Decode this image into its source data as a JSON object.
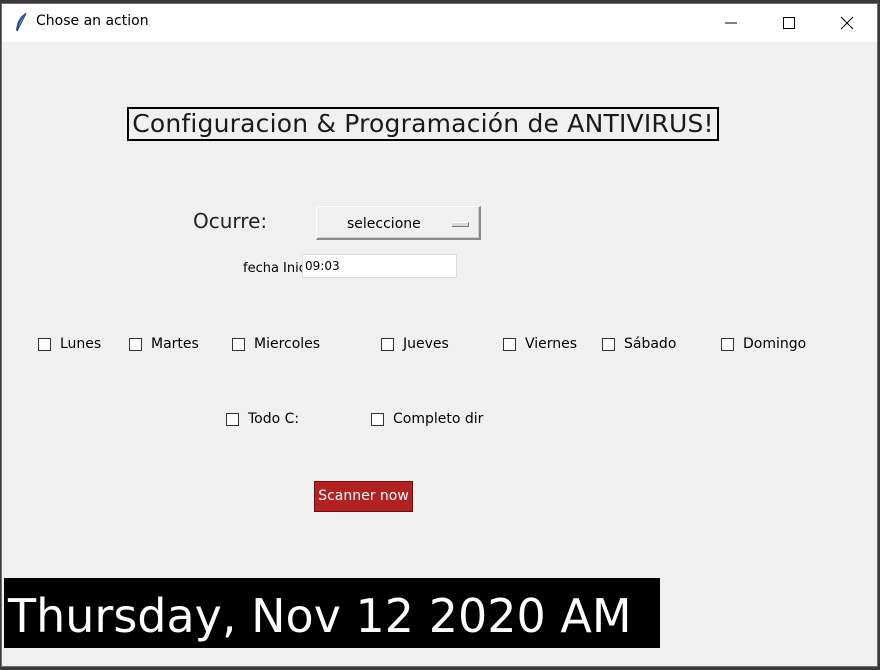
{
  "window": {
    "title": "Chose an action",
    "icons": {
      "app": "feather-icon",
      "minimize": "minimize-icon",
      "maximize": "maximize-icon",
      "close": "close-icon"
    }
  },
  "heading": "Configuracion & Programación de ANTIVIRUS!",
  "ocurre": {
    "label": "Ocurre:",
    "selected": "seleccione"
  },
  "fecha": {
    "label": "fecha Inicio",
    "value": "09:03"
  },
  "days": [
    {
      "label": "Lunes",
      "checked": false
    },
    {
      "label": "Martes",
      "checked": false
    },
    {
      "label": "Miercoles",
      "checked": false
    },
    {
      "label": "Jueves",
      "checked": false
    },
    {
      "label": "Viernes",
      "checked": false
    },
    {
      "label": "Sábado",
      "checked": false
    },
    {
      "label": "Domingo",
      "checked": false
    }
  ],
  "scope": [
    {
      "label": "Todo C:",
      "checked": false
    },
    {
      "label": "Completo dir",
      "checked": false
    }
  ],
  "scan_button": "Scanner now",
  "clock": "Thursday, Nov 12 2020 AM",
  "colors": {
    "scan_button": "#b22222",
    "clock_bg": "#000000",
    "clock_text": "#ffffff"
  }
}
